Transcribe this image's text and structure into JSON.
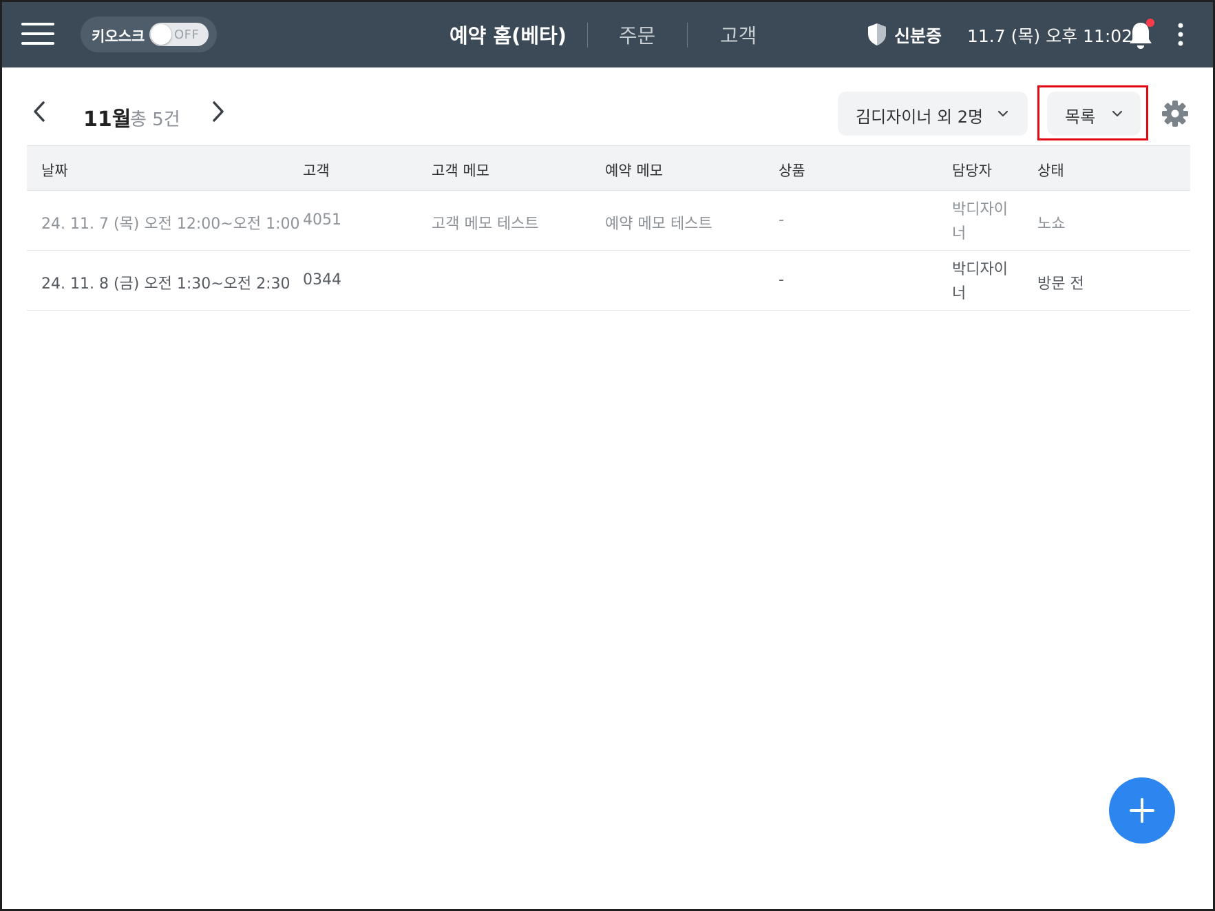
{
  "topbar": {
    "kiosk_label": "키오스크",
    "kiosk_toggle": "OFF",
    "nav_reservation": "예약 홈(베타)",
    "nav_order": "주문",
    "nav_customer": "고객",
    "id_label": "신분증",
    "datetime": "11.7 (목) 오후 11:02",
    "icons": {
      "menu": "hamburger-menu-icon",
      "id": "shield-icon",
      "notification": "bell-icon",
      "more": "kebab-menu-icon"
    },
    "notification_dot_color": "#ff3b4a"
  },
  "subheader": {
    "month": "11월",
    "total": "총 5건",
    "staff_filter": "김디자이너 외 2명",
    "view_mode": "목록",
    "icons": {
      "prev": "chevron-left-icon",
      "next": "chevron-right-icon",
      "settings": "gear-icon"
    }
  },
  "table": {
    "headers": [
      "날짜",
      "고객",
      "고객 메모",
      "예약 메모",
      "상품",
      "담당자",
      "상태"
    ],
    "rows": [
      {
        "date": "24. 11. 7 (목) 오전 12:00~오전 1:00",
        "customer": "4051",
        "customer_memo": "고객 메모 테스트",
        "reservation_memo": "예약 메모 테스트",
        "product": "-",
        "staff": "박디자이너",
        "status": "노쇼"
      },
      {
        "date": "24. 11. 8 (금) 오전 1:30~오전 2:30",
        "customer": "0344",
        "customer_memo": "",
        "reservation_memo": "",
        "product": "-",
        "staff": "박디자이너",
        "status": "방문 전"
      }
    ]
  },
  "fab": {
    "icon": "plus-icon",
    "color": "#2d86f0"
  },
  "colors": {
    "topbar": "#3c4a57",
    "highlight": "#e30613"
  }
}
